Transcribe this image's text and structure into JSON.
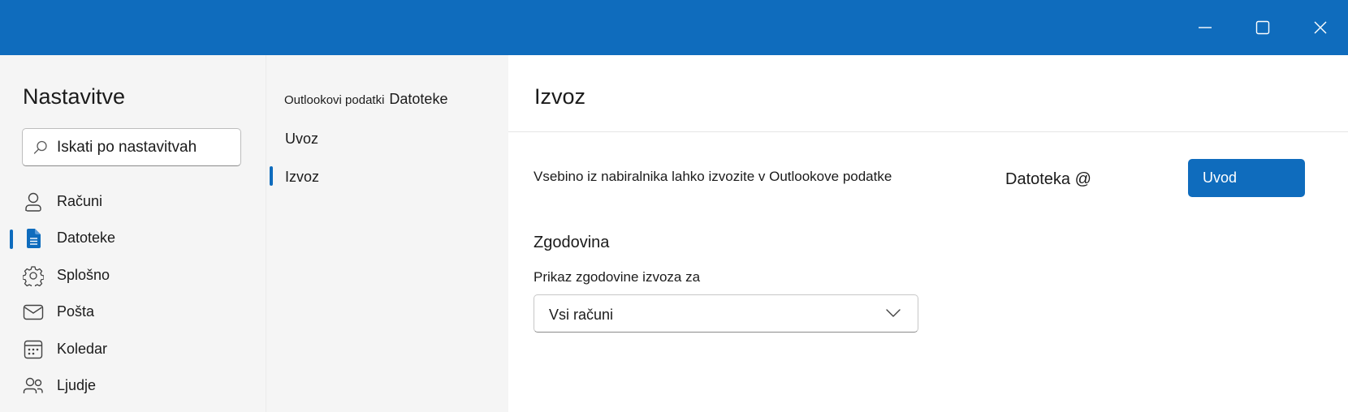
{
  "window": {
    "accent": "#0f6cbd",
    "controls": [
      {
        "name": "minimize",
        "icon": "minimize-icon"
      },
      {
        "name": "maximize",
        "icon": "maximize-icon"
      },
      {
        "name": "close",
        "icon": "close-icon"
      }
    ]
  },
  "sidebar": {
    "title": "Nastavitve",
    "search": {
      "placeholder": "Iskati po nastavitvah",
      "icon": "search-icon"
    },
    "items": [
      {
        "label": "Računi",
        "icon": "person-icon",
        "selected": false
      },
      {
        "label": "Datoteke",
        "icon": "document-icon",
        "selected": true
      },
      {
        "label": "Splošno",
        "icon": "gear-icon",
        "selected": false
      },
      {
        "label": "Pošta",
        "icon": "mail-icon",
        "selected": false
      },
      {
        "label": "Koledar",
        "icon": "calendar-icon",
        "selected": false
      },
      {
        "label": "Ljudje",
        "icon": "people-icon",
        "selected": false
      }
    ]
  },
  "subnav": {
    "heading_small": "Outlookovi podatki",
    "heading_big": "Datoteke",
    "items": [
      {
        "label": "Uvoz",
        "selected": false
      },
      {
        "label": "Izvoz",
        "selected": true
      }
    ]
  },
  "content": {
    "title": "Izvoz",
    "export_description": "Vsebino iz nabiralnika lahko izvozite v Outlookove podatke",
    "file_label": "Datoteka @",
    "primary_button": "Uvod",
    "history_section": "Zgodovina",
    "history_label": "Prikaz zgodovine izvoza za",
    "history_selected": "Vsi računi",
    "dropdown_icon": "chevron-down-icon"
  }
}
